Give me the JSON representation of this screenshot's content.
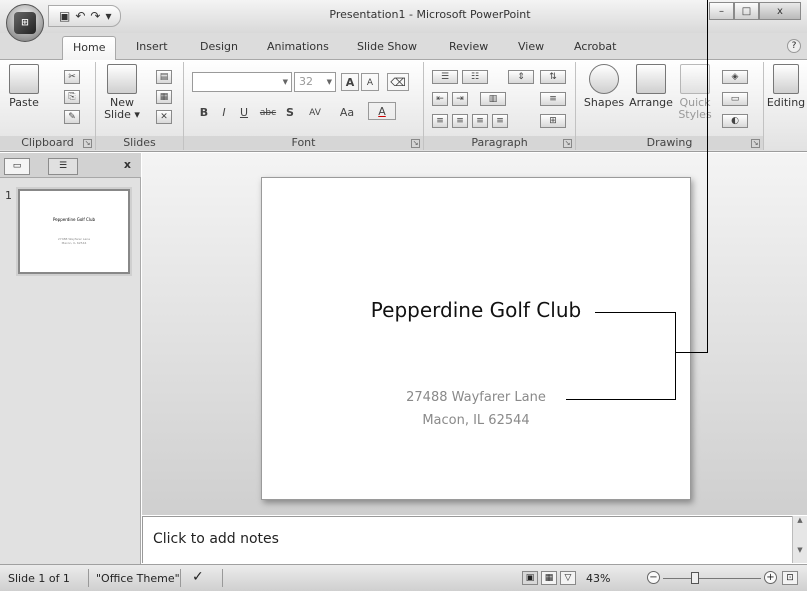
{
  "window": {
    "title": "Presentation1 - Microsoft PowerPoint",
    "office_button": "Office",
    "minimize": "–",
    "maximize": "□",
    "close": "x"
  },
  "qat": {
    "save_icon": "save-icon",
    "undo": "↶",
    "redo": "↷",
    "customize": "▾"
  },
  "tabs": [
    {
      "label": "Home",
      "active": true
    },
    {
      "label": "Insert"
    },
    {
      "label": "Design"
    },
    {
      "label": "Animations"
    },
    {
      "label": "Slide Show"
    },
    {
      "label": "Review"
    },
    {
      "label": "View"
    },
    {
      "label": "Acrobat"
    }
  ],
  "ribbon": {
    "clipboard": {
      "label": "Clipboard",
      "paste": "Paste"
    },
    "slides": {
      "label": "Slides",
      "new_slide_1": "New",
      "new_slide_2": "Slide ▾"
    },
    "font": {
      "label": "Font",
      "size": "32",
      "bold": "B",
      "italic": "I",
      "underline": "U",
      "strike": "abc",
      "shadow": "S",
      "spacing": "AV",
      "case": "Aa",
      "color": "A",
      "grow": "A",
      "shrink": "A"
    },
    "paragraph": {
      "label": "Paragraph"
    },
    "drawing": {
      "label": "Drawing",
      "shapes": "Shapes",
      "arrange": "Arrange",
      "quick_styles_1": "Quick",
      "quick_styles_2": "Styles"
    },
    "editing": {
      "label": "Editing"
    }
  },
  "panel": {
    "tab_close": "x",
    "slide_number": "1"
  },
  "slide": {
    "title": "Pepperdine Golf Club",
    "line1": "27488 Wayfarer Lane",
    "line2": "Macon, IL 62544"
  },
  "notes": {
    "placeholder": "Click to add notes"
  },
  "status": {
    "slide_info": "Slide 1 of 1",
    "theme": "\"Office Theme\"",
    "zoom": "43%"
  }
}
